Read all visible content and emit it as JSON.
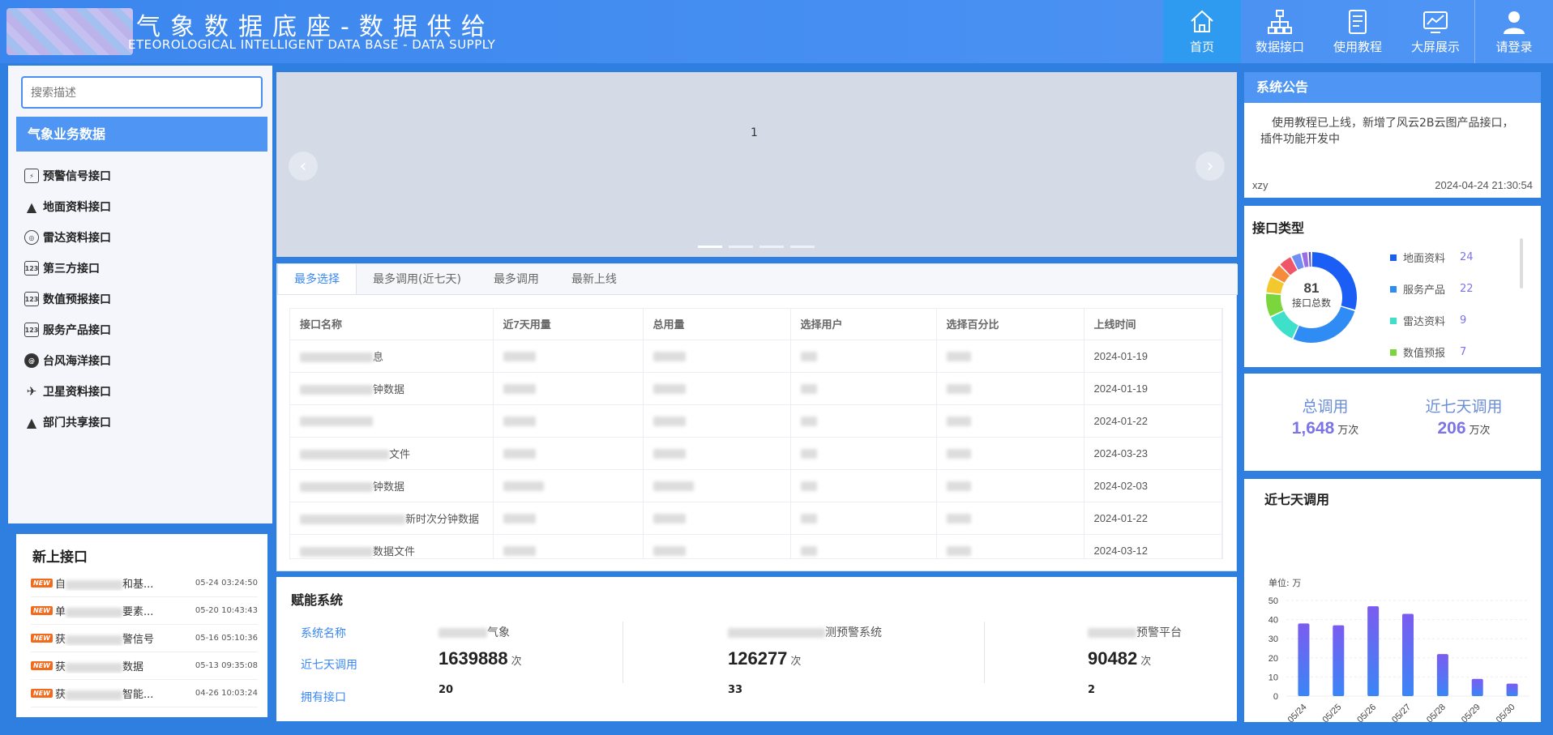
{
  "header": {
    "title_cn": "气象数据底座-数据供给",
    "title_en": "ETEOROLOGICAL INTELLIGENT DATA BASE - DATA SUPPLY",
    "nav": [
      {
        "label": "首页",
        "icon": "home-icon"
      },
      {
        "label": "数据接口",
        "icon": "hierarchy-icon"
      },
      {
        "label": "使用教程",
        "icon": "document-icon"
      },
      {
        "label": "大屏展示",
        "icon": "chart-screen-icon"
      },
      {
        "label": "请登录",
        "icon": "user-icon"
      }
    ]
  },
  "sidebar": {
    "search_placeholder": "搜索描述",
    "category_title": "气象业务数据",
    "items": [
      {
        "label": "预警信号接口",
        "icon": "warning-icon"
      },
      {
        "label": "地面资料接口",
        "icon": "mountain-icon"
      },
      {
        "label": "雷达资料接口",
        "icon": "radar-icon"
      },
      {
        "label": "第三方接口",
        "icon": "api-123-icon"
      },
      {
        "label": "数值预报接口",
        "icon": "api-123-icon"
      },
      {
        "label": "服务产品接口",
        "icon": "api-123-icon"
      },
      {
        "label": "台风海洋接口",
        "icon": "typhoon-icon"
      },
      {
        "label": "卫星资料接口",
        "icon": "satellite-icon"
      },
      {
        "label": "部门共享接口",
        "icon": "mountain-icon"
      }
    ]
  },
  "new_interfaces": {
    "title": "新上接口",
    "badge": "NEW",
    "items": [
      {
        "prefix": "自",
        "suffix": "和基...",
        "date": "05-24 03:24:50"
      },
      {
        "prefix": "单",
        "suffix": "要素...",
        "date": "05-20 10:43:43"
      },
      {
        "prefix": "获",
        "suffix": "警信号",
        "date": "05-16 05:10:36"
      },
      {
        "prefix": "获",
        "suffix": "数据",
        "date": "05-13 09:35:08"
      },
      {
        "prefix": "获",
        "suffix": "智能...",
        "date": "04-26 10:03:24"
      }
    ]
  },
  "carousel": {
    "slide_number": "1",
    "prev": "‹",
    "next": "›"
  },
  "tabs": [
    "最多选择",
    "最多调用(近七天)",
    "最多调用",
    "最新上线"
  ],
  "table": {
    "headers": [
      "接口名称",
      "近7天用量",
      "总用量",
      "选择用户",
      "选择百分比",
      "上线时间"
    ],
    "rows": [
      {
        "name_suffix": "息",
        "date": "2024-01-19"
      },
      {
        "name_suffix": "钟数据",
        "date": "2024-01-19"
      },
      {
        "name_suffix": "",
        "date": "2024-01-22"
      },
      {
        "name_suffix": "文件",
        "date": "2024-03-23"
      },
      {
        "name_suffix": "钟数据",
        "date": "2024-02-03"
      },
      {
        "name_suffix": "新时次分钟数据",
        "date": "2024-01-22"
      },
      {
        "name_suffix": "数据文件",
        "date": "2024-03-12"
      }
    ]
  },
  "empower": {
    "title": "赋能系统",
    "labels": [
      "系统名称",
      "近七天调用",
      "拥有接口"
    ],
    "unit": "次",
    "systems": [
      {
        "name_suffix": "气象",
        "calls": "1639888",
        "interfaces": "20"
      },
      {
        "name_suffix": "测预警系统",
        "calls": "126277",
        "interfaces": "33"
      },
      {
        "name_suffix": "预警平台",
        "calls": "90482",
        "interfaces": "2"
      }
    ]
  },
  "notice": {
    "title": "系统公告",
    "body": "使用教程已上线，新增了风云2B云图产品接口，插件功能开发中",
    "author": "xzy",
    "time": "2024-04-24 21:30:54"
  },
  "interface_types": {
    "title": "接口类型",
    "total": "81",
    "total_label": "接口总数",
    "legend": [
      {
        "name": "地面资料",
        "value": 24,
        "color": "#1a5ef5"
      },
      {
        "name": "服务产品",
        "value": 22,
        "color": "#2f8cf5"
      },
      {
        "name": "雷达资料",
        "value": 9,
        "color": "#3ee0c9"
      },
      {
        "name": "数值预报",
        "value": 7,
        "color": "#7bd63d"
      }
    ],
    "other_segments": [
      {
        "value": 5,
        "color": "#f2c82e"
      },
      {
        "value": 4,
        "color": "#f58c3b"
      },
      {
        "value": 4,
        "color": "#f0566a"
      },
      {
        "value": 3,
        "color": "#6f8ff5"
      },
      {
        "value": 2,
        "color": "#9a6ee6"
      },
      {
        "value": 1,
        "color": "#5d4bd6"
      }
    ]
  },
  "totals": {
    "total_label": "总调用",
    "total_value": "1,648",
    "week_label": "近七天调用",
    "week_value": "206",
    "unit": "万次"
  },
  "chart_data": {
    "type": "bar",
    "title": "近七天调用",
    "ylabel": "单位: 万",
    "categories": [
      "05/24",
      "05/25",
      "05/26",
      "05/27",
      "05/28",
      "05/29",
      "05/30"
    ],
    "values": [
      38,
      37,
      47,
      43,
      22,
      9,
      6.5
    ],
    "ylim": [
      0,
      50
    ],
    "yticks": [
      0,
      10,
      20,
      30,
      40,
      50
    ],
    "bar_color_top": "#7b5cf0",
    "bar_color_bottom": "#3a86f6"
  }
}
